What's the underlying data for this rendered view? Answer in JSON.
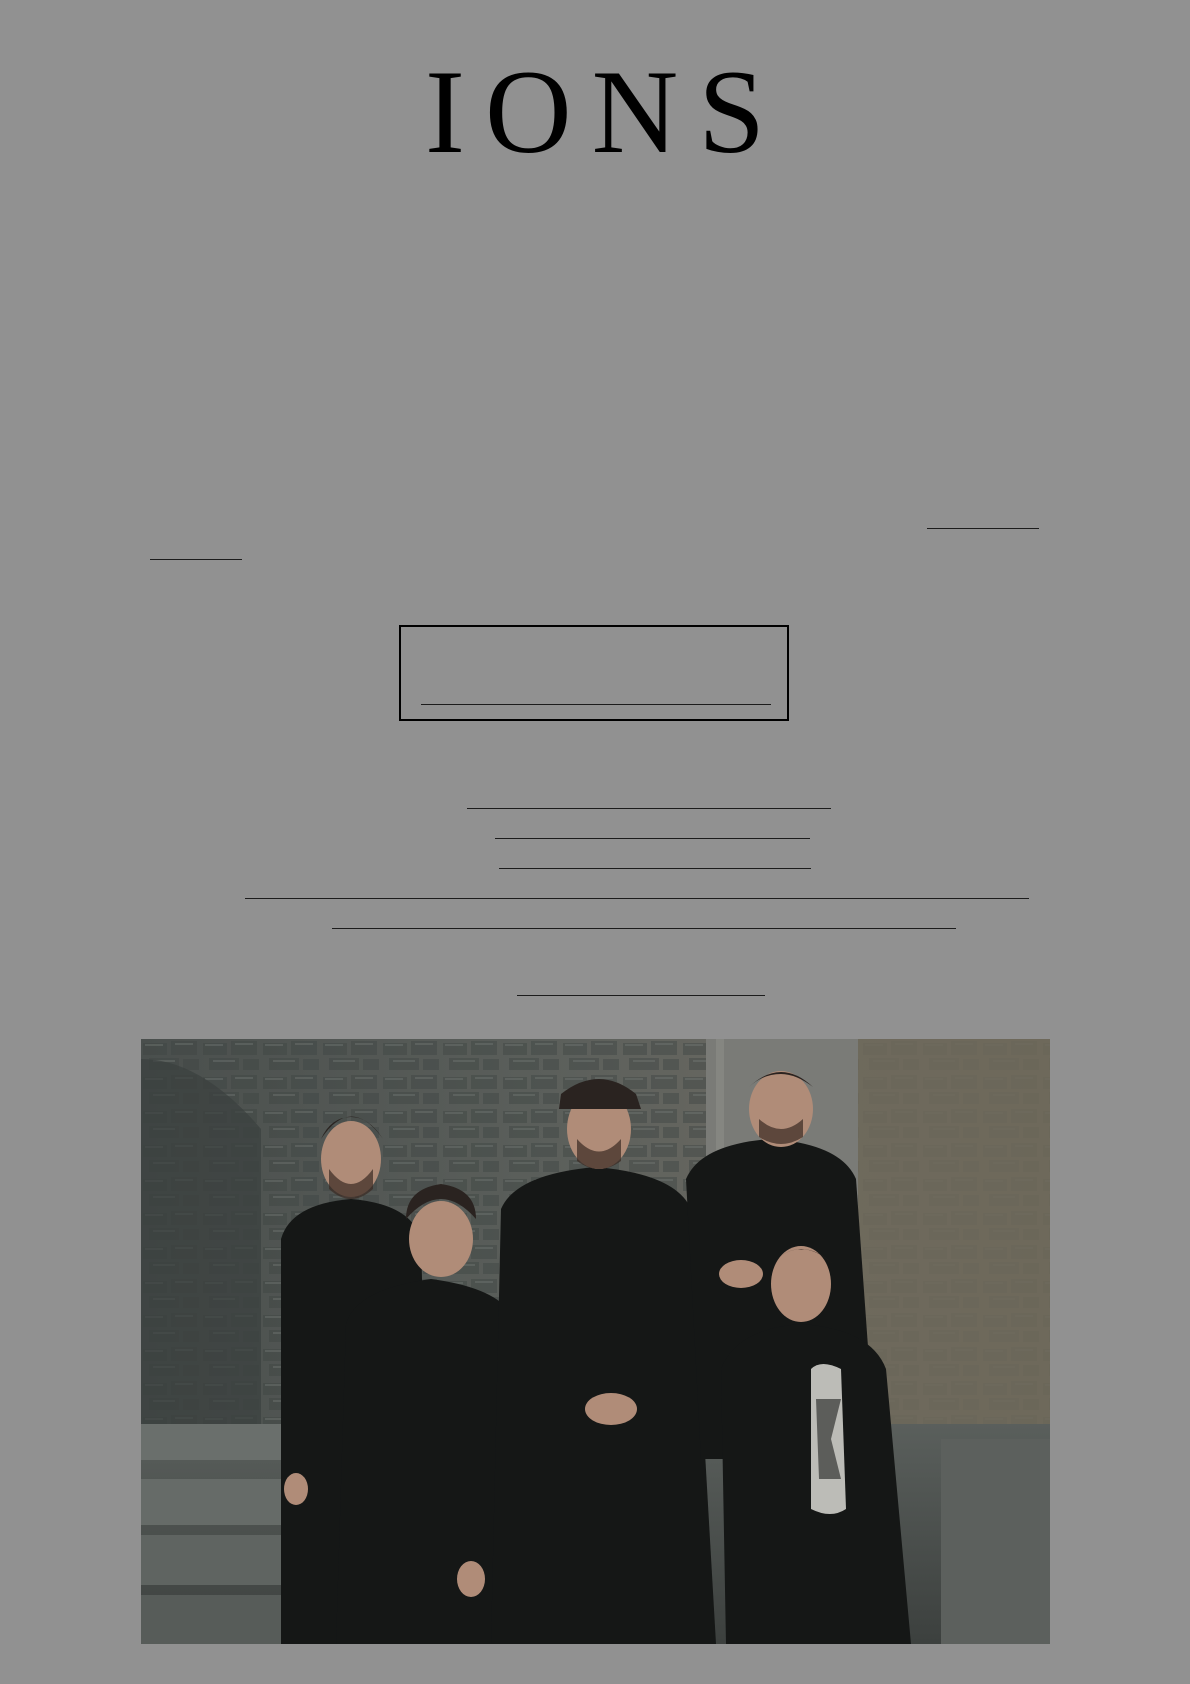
{
  "header": {
    "logo_text": "IONS"
  },
  "intro": {
    "links": [
      "",
      ""
    ]
  },
  "cta": {
    "label": ""
  },
  "links": [
    "",
    "",
    "",
    "",
    ""
  ],
  "footer_link": {
    "label": ""
  },
  "photo": {
    "alt": ""
  }
}
